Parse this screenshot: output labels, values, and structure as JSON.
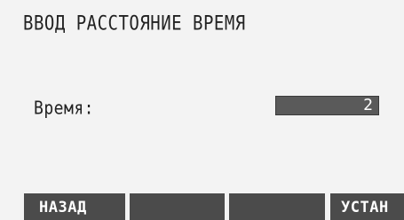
{
  "screen": {
    "title": "ВВОД РАССТОЯНИЕ ВРЕМЯ"
  },
  "field": {
    "label": "Время:",
    "value": "2"
  },
  "softkeys": {
    "f1_label": "НАЗАД",
    "f2_label": "",
    "f3_label": "",
    "f4_label": "УСТАН"
  },
  "colors": {
    "background": "#f3f3f3",
    "softkey_bg": "#4b4b4b",
    "value_bg": "#5a5a5a",
    "text": "#222222"
  }
}
